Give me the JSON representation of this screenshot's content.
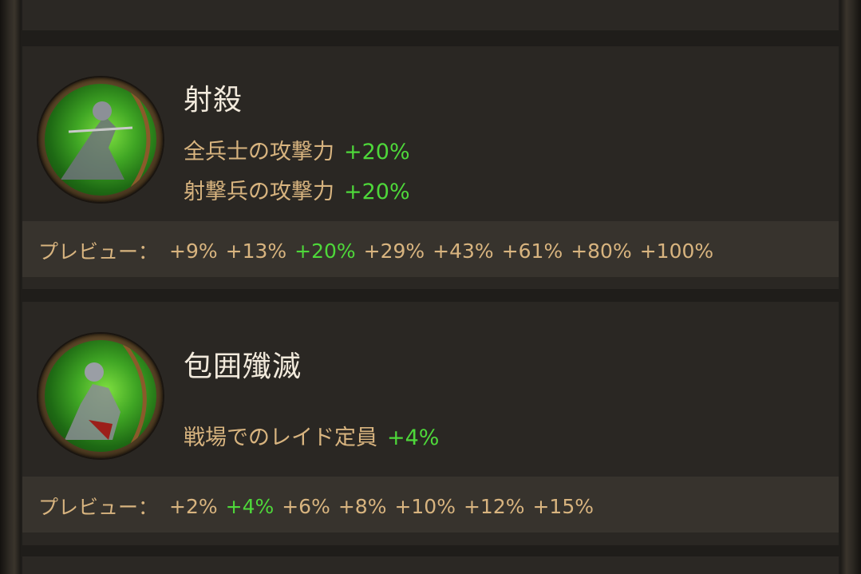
{
  "skills": [
    {
      "title": "射殺",
      "effects": [
        {
          "label": "全兵士の攻撃力",
          "value": "+20%"
        },
        {
          "label": "射撃兵の攻撃力",
          "value": "+20%"
        }
      ],
      "preview_label": "プレビュー：",
      "preview_values": [
        "+9%",
        "+13%",
        "+20%",
        "+29%",
        "+43%",
        "+61%",
        "+80%",
        "+100%"
      ],
      "current_index": 2
    },
    {
      "title": "包囲殲滅",
      "effects": [
        {
          "label": "戦場でのレイド定員",
          "value": "+4%"
        }
      ],
      "preview_label": "プレビュー：",
      "preview_values": [
        "+2%",
        "+4%",
        "+6%",
        "+8%",
        "+10%",
        "+12%",
        "+15%"
      ],
      "current_index": 1
    }
  ],
  "colors": {
    "panel_bg": "#2a2723",
    "preview_bg": "#37332d",
    "title": "#f2eadc",
    "text_gold": "#d8b47f",
    "highlight_green": "#4ed83a",
    "medal_green": "#3fa524"
  },
  "icons": {
    "skill_1": "archer-knight-aiming-icon",
    "skill_2": "archer-knight-kneeling-icon"
  }
}
